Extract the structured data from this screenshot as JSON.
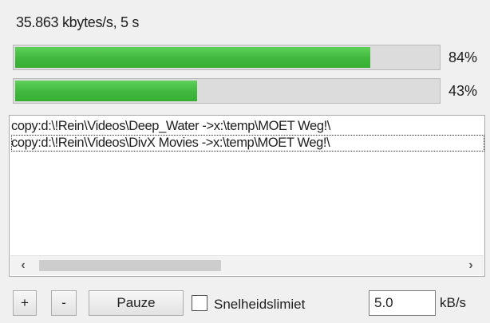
{
  "status": {
    "transfer_text": "35.863 kbytes/s, 5 s"
  },
  "progress": [
    {
      "label": "84%",
      "fraction": 0.84
    },
    {
      "label": "43%",
      "fraction": 0.43
    }
  ],
  "queue": {
    "items": [
      "copy:d:\\!Rein\\Videos\\Deep_Water ->x:\\temp\\MOET Weg!\\",
      "copy:d:\\!Rein\\Videos\\DivX Movies ->x:\\temp\\MOET Weg!\\"
    ],
    "scroll_left_icon": "chevron-left-icon",
    "scroll_right_icon": "chevron-right-icon"
  },
  "controls": {
    "add_label": "+",
    "remove_label": "-",
    "pause_label": "Pauze",
    "speed_limit_label": "Snelheidslimiet",
    "speed_limit_checked": false,
    "speed_value": "5.0",
    "speed_unit": "kB/s"
  },
  "colors": {
    "progress_fill": "#3fb83c",
    "background": "#f0f0f0"
  }
}
